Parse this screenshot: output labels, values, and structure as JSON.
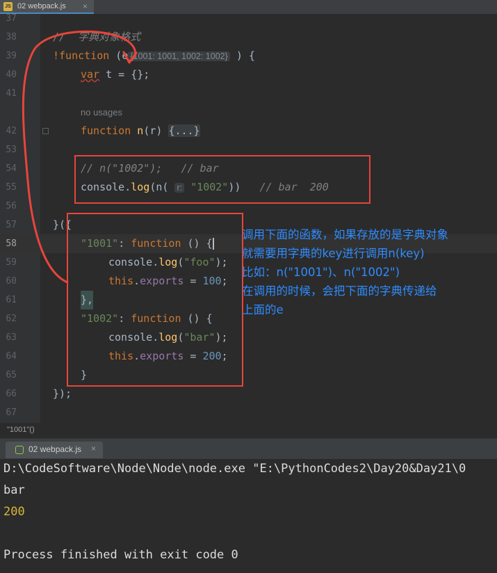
{
  "editor_tab": {
    "icon": "JS",
    "label": "02 webpack.js",
    "close": "×"
  },
  "lines": [
    {
      "n": "37"
    },
    {
      "n": "38",
      "comment": "//  字典对象格式"
    },
    {
      "n": "39",
      "bang": "!",
      "kw": "function",
      "hint": "{1001: 1001, 1002: 1002}",
      "rest": ") {",
      "param": "e"
    },
    {
      "n": "40",
      "kw": "var",
      "name": "t",
      "rest": " = {};"
    },
    {
      "n": "41"
    },
    {
      "n": "",
      "usage": "no usages"
    },
    {
      "n": "42",
      "kw": "function",
      "fname": "n",
      "param": "r",
      "folded": "{...}"
    },
    {
      "n": "53"
    },
    {
      "n": "54",
      "comment": "// n(\"1002\");   // bar"
    },
    {
      "n": "55",
      "obj": "console",
      "method": "log",
      "param_hint": "r:",
      "arg": "\"1002\"",
      "comment": "// bar  200"
    },
    {
      "n": "56"
    },
    {
      "n": "57",
      "text": "}({"
    },
    {
      "n": "58",
      "key": "\"1001\"",
      "kw": "function",
      "rest": " () {"
    },
    {
      "n": "59",
      "obj": "console",
      "method": "log",
      "arg": "\"foo\""
    },
    {
      "n": "60",
      "this": "this",
      "prop": "exports",
      "val": "100"
    },
    {
      "n": "61",
      "text": "},"
    },
    {
      "n": "62",
      "key": "\"1002\"",
      "kw": "function",
      "rest": " () {"
    },
    {
      "n": "63",
      "obj": "console",
      "method": "log",
      "arg": "\"bar\""
    },
    {
      "n": "64",
      "this": "this",
      "prop": "exports",
      "val": "200"
    },
    {
      "n": "65",
      "text": "}"
    },
    {
      "n": "66",
      "text": "});"
    },
    {
      "n": "67"
    }
  ],
  "annotation": [
    "调用下面的函数，如果存放的是字典对象",
    "就需要用字典的key进行调用n(key)",
    "比如：n(\"1001\")、n(\"1002\")",
    "在调用的时候，会把下面的字典传递给",
    "上面的e"
  ],
  "status": {
    "breadcrumb": "\"1001\"()"
  },
  "run_tab": {
    "label": "02 webpack.js",
    "close": "×"
  },
  "console": {
    "command": "D:\\CodeSoftware\\Node\\Node\\node.exe \"E:\\PythonCodes2\\Day20&Day21\\0",
    "out1": "bar",
    "out2": "200",
    "finish": "Process finished with exit code 0"
  },
  "colors": {
    "keyword": "#cc7832",
    "string": "#6a8759",
    "number": "#6897bb",
    "function": "#ffc66d",
    "annotation": "#2f8cff",
    "box": "#e8453c"
  }
}
